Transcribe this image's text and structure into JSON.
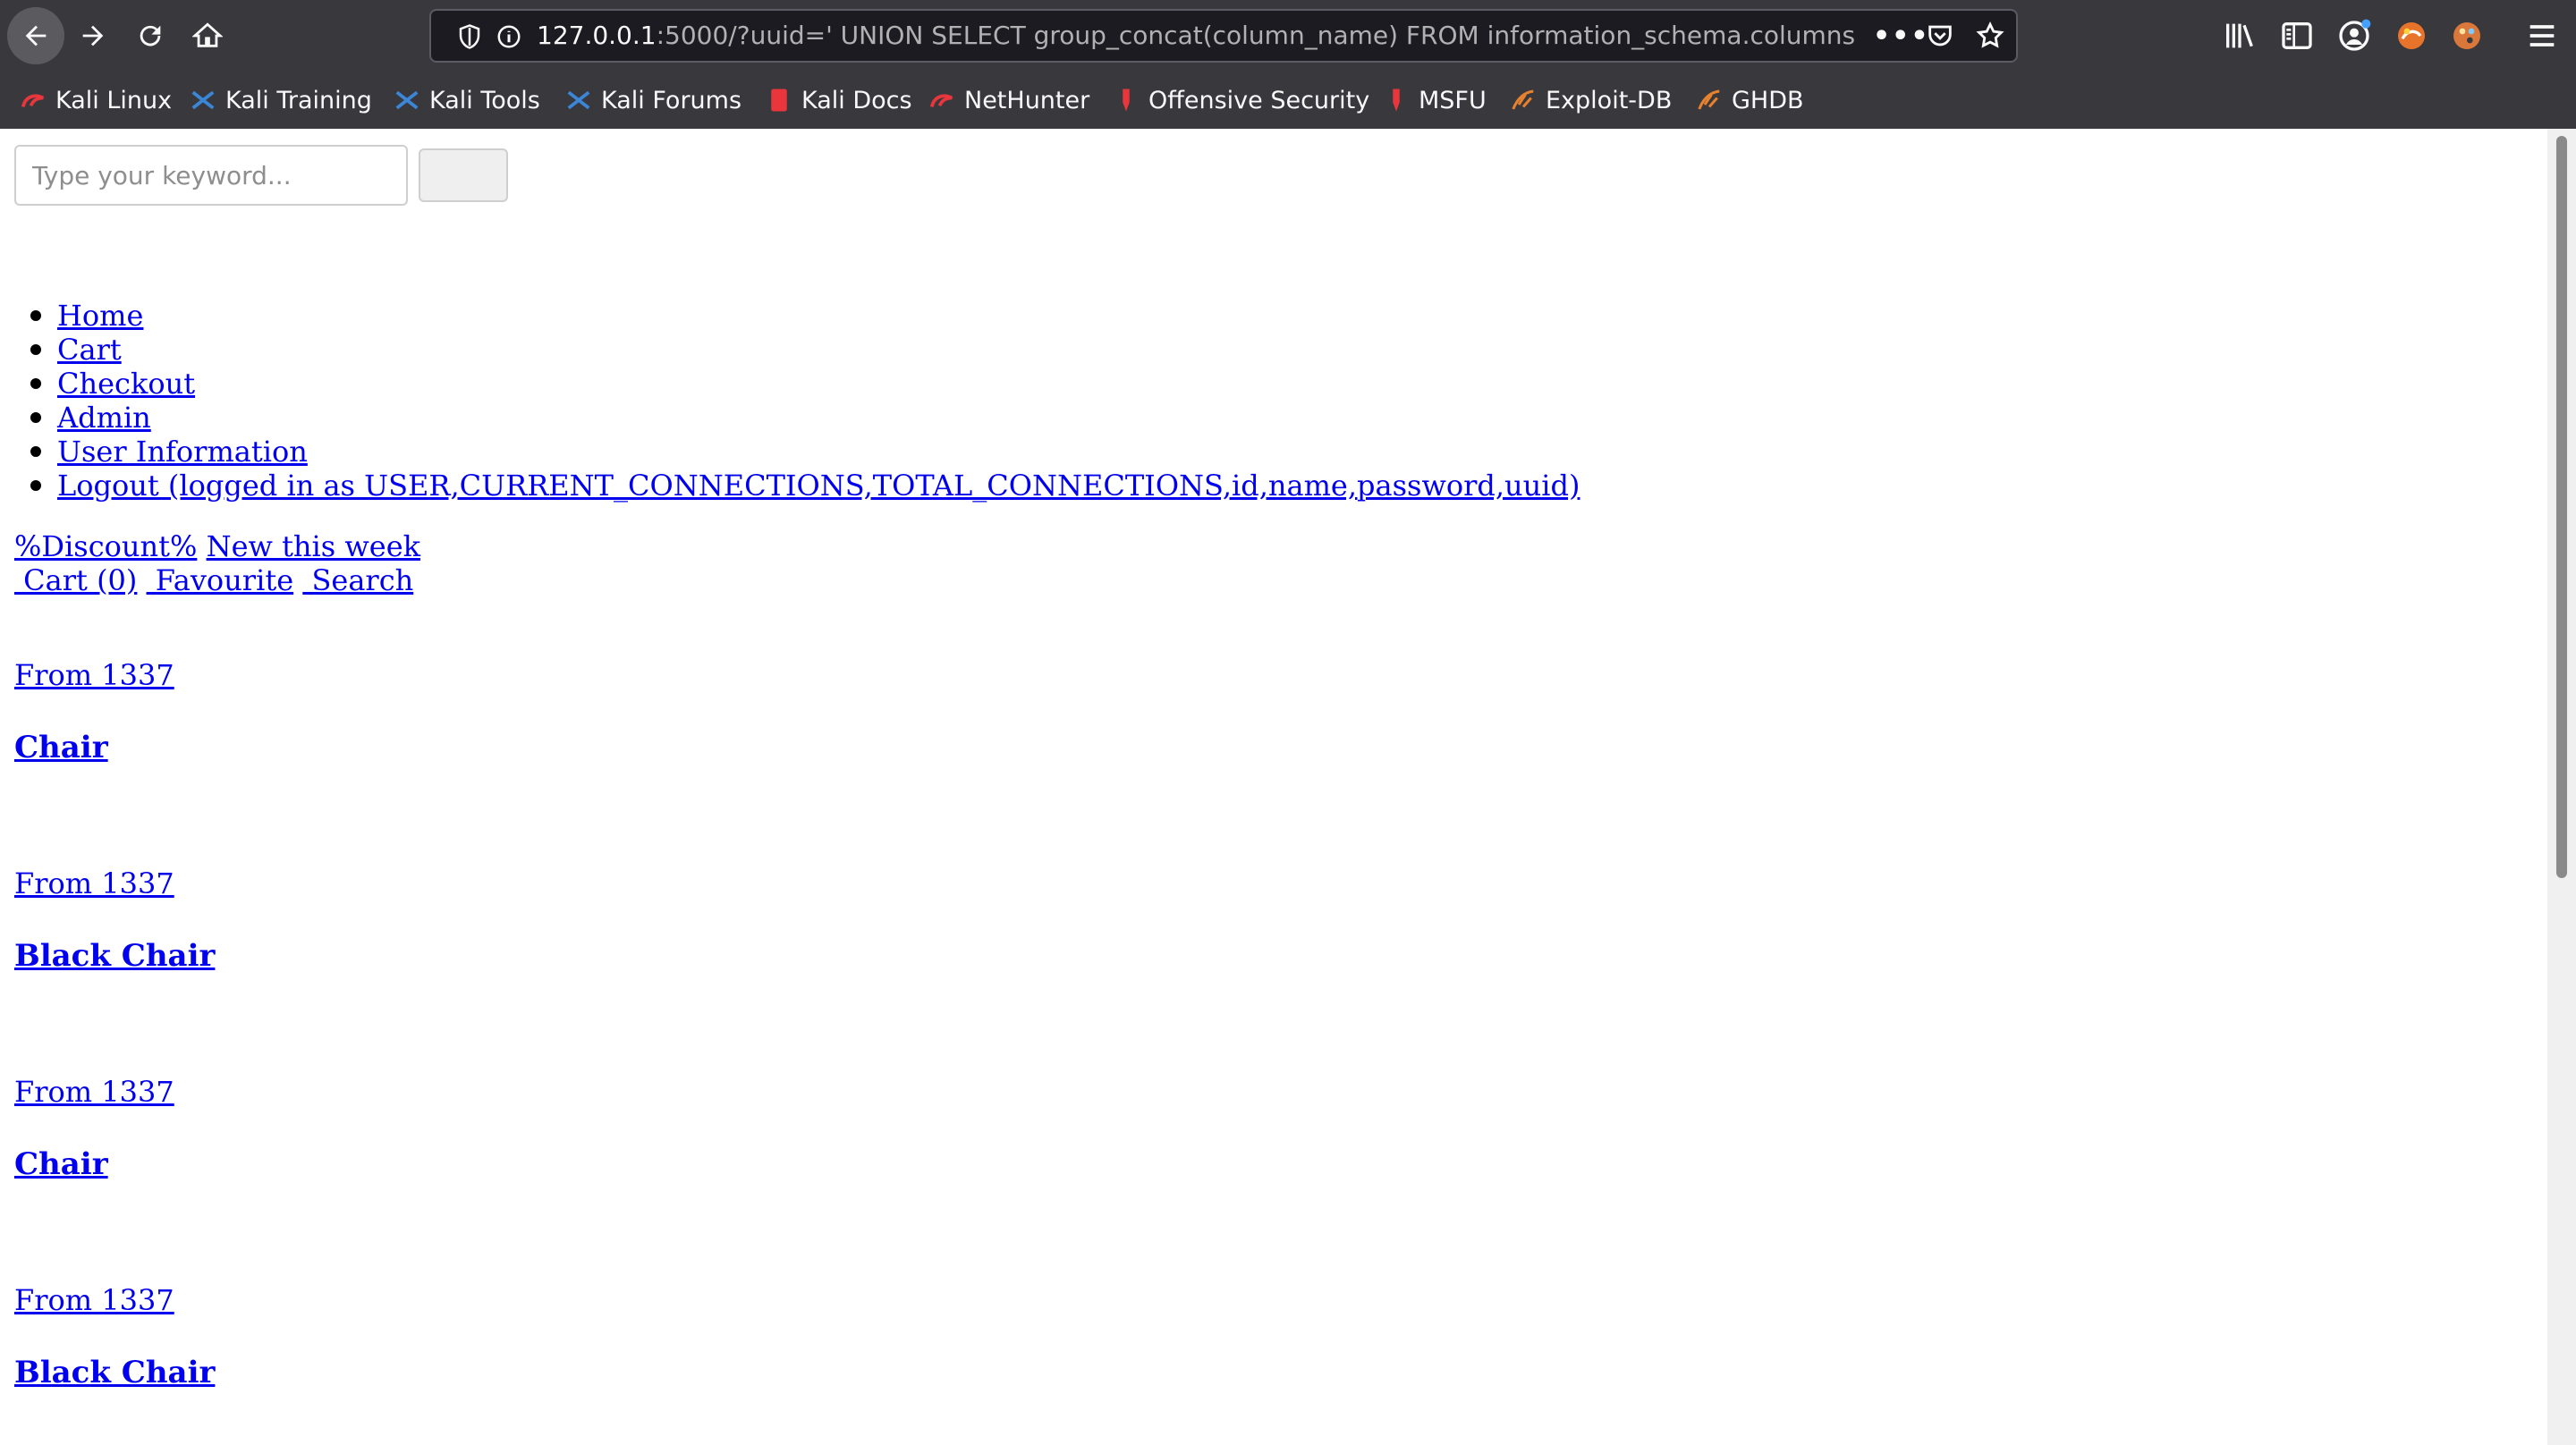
{
  "browser": {
    "url_host": "127.0.0.1",
    "url_rest": ":5000/?uuid=' UNION SELECT group_concat(column_name) FROM information_schema.columns",
    "url_more": "•••"
  },
  "bookmarks": [
    {
      "label": "Kali Linux",
      "icon": "kali-dragon-icon",
      "color": "#e8363c"
    },
    {
      "label": "Kali Training",
      "icon": "kali-training-icon",
      "color": "#3b86d6"
    },
    {
      "label": "Kali Tools",
      "icon": "kali-tools-icon",
      "color": "#3b86d6"
    },
    {
      "label": "Kali Forums",
      "icon": "kali-forums-icon",
      "color": "#3b86d6"
    },
    {
      "label": "Kali Docs",
      "icon": "kali-docs-icon",
      "color": "#e8363c"
    },
    {
      "label": "NetHunter",
      "icon": "nethunter-icon",
      "color": "#e8363c"
    },
    {
      "label": "Offensive Security",
      "icon": "offsec-icon",
      "color": "#e8363c"
    },
    {
      "label": "MSFU",
      "icon": "msfu-icon",
      "color": "#e8363c"
    },
    {
      "label": "Exploit-DB",
      "icon": "exploit-db-icon",
      "color": "#e6822e"
    },
    {
      "label": "GHDB",
      "icon": "ghdb-icon",
      "color": "#e6822e"
    }
  ],
  "search": {
    "placeholder": "Type your keyword..."
  },
  "menu": [
    "Home",
    "Cart",
    "Checkout",
    "Admin",
    "User Information",
    "Logout (logged in as USER,CURRENT_CONNECTIONS,TOTAL_CONNECTIONS,id,name,password,uuid)"
  ],
  "promo": {
    "discount": "%Discount%",
    "new_week": "New this week"
  },
  "actions": {
    "cart": " Cart (0)",
    "favourite": " Favourite",
    "search": " Search"
  },
  "products": [
    {
      "price": "From 1337",
      "name": "Chair"
    },
    {
      "price": "From 1337",
      "name": "Black Chair"
    },
    {
      "price": "From 1337",
      "name": "Chair"
    },
    {
      "price": "From 1337",
      "name": "Black Chair"
    }
  ]
}
